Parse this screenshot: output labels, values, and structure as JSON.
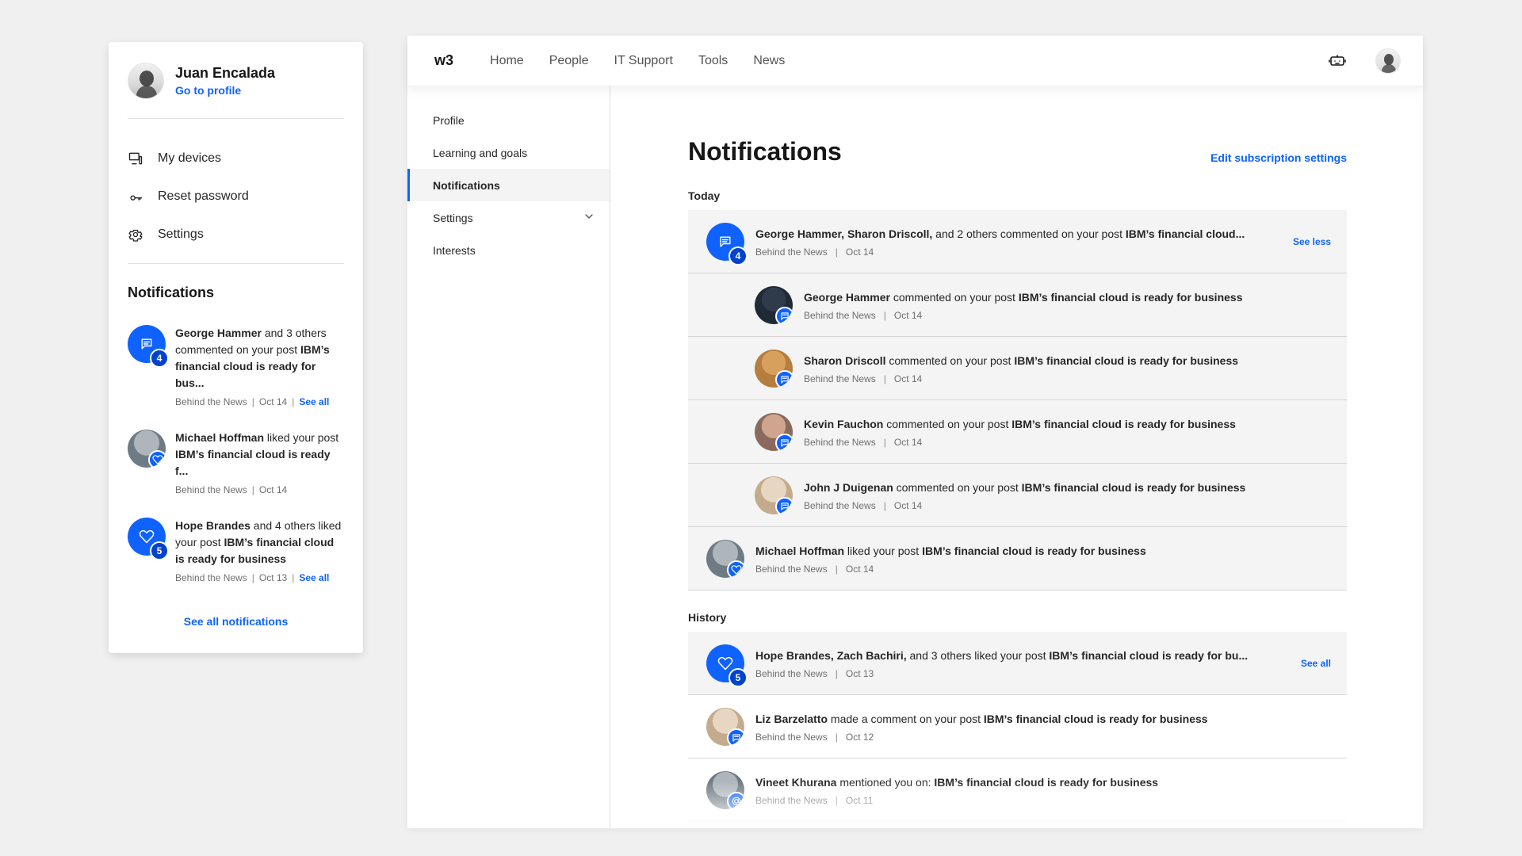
{
  "left_panel": {
    "profile": {
      "name": "Juan Encalada",
      "profile_link": "Go to profile"
    },
    "menu": [
      {
        "label": "My devices",
        "icon": "devices-icon"
      },
      {
        "label": "Reset password",
        "icon": "key-icon"
      },
      {
        "label": "Settings",
        "icon": "gear-icon"
      }
    ],
    "notifications_title": "Notifications",
    "notifications": [
      {
        "type": "group",
        "count": "4",
        "icon": "chat-icon",
        "lead": "George Hammer",
        "rest1": " and 3 others commented on your post ",
        "post": "IBM’s financial cloud is ready for bus...",
        "meta_source": "Behind the News",
        "meta_date": "Oct 14",
        "meta_link": "See all"
      },
      {
        "type": "person",
        "icon": "heart-icon",
        "lead": "Michael Hoffman",
        "rest1": " liked your post ",
        "post": "IBM’s financial cloud is ready f...",
        "meta_source": "Behind the News",
        "meta_date": "Oct 14"
      },
      {
        "type": "group",
        "count": "5",
        "icon": "heart-icon",
        "lead": "Hope Brandes",
        "rest1": " and 4 others liked your post ",
        "post": "IBM’s financial cloud is ready for business",
        "meta_source": "Behind the News",
        "meta_date": "Oct 13",
        "meta_link": "See all"
      }
    ],
    "see_all_notifications": "See all notifications"
  },
  "app": {
    "brand": "w3",
    "nav": [
      "Home",
      "People",
      "IT Support",
      "Tools",
      "News"
    ],
    "sidenav": [
      {
        "label": "Profile"
      },
      {
        "label": "Learning and goals"
      },
      {
        "label": "Notifications",
        "active": true
      },
      {
        "label": "Settings",
        "has_chevron": true
      },
      {
        "label": "Interests"
      }
    ],
    "page_title": "Notifications",
    "edit_link": "Edit subscription settings",
    "today_label": "Today",
    "history_label": "History",
    "today": [
      {
        "kind": "group",
        "count": "4",
        "icon": "chat-icon",
        "lead": "George Hammer, Sharon Driscoll,",
        "rest": " and 2 others commented on your post ",
        "post": "IBM’s financial cloud...",
        "source": "Behind the News",
        "date": "Oct 14",
        "right_link": "See less"
      },
      {
        "kind": "child",
        "avatar_style": "face-dark",
        "icon": "chat-icon",
        "lead": "George Hammer",
        "rest": " commented on your post ",
        "post": "IBM’s financial cloud is ready for business",
        "source": "Behind the News",
        "date": "Oct 14"
      },
      {
        "kind": "child",
        "avatar_style": "face-blonde",
        "icon": "chat-icon",
        "lead": "Sharon Driscoll",
        "rest": " commented on your post ",
        "post": "IBM’s financial cloud is ready for business",
        "source": "Behind the News",
        "date": "Oct 14"
      },
      {
        "kind": "child",
        "avatar_style": "face-bald",
        "icon": "chat-icon",
        "lead": "Kevin Fauchon",
        "rest": " commented on your post ",
        "post": "IBM’s financial cloud is ready for business",
        "source": "Behind the News",
        "date": "Oct 14"
      },
      {
        "kind": "child",
        "avatar_style": "face-light",
        "icon": "chat-icon",
        "lead": "John J Duigenan",
        "rest": " commented on your post ",
        "post": "IBM’s financial cloud is ready for business",
        "source": "Behind the News",
        "date": "Oct 14"
      },
      {
        "kind": "person",
        "avatar_style": "face-gray",
        "icon": "heart-icon",
        "lead": "Michael Hoffman",
        "rest": " liked your post ",
        "post": "IBM’s financial cloud is ready for business",
        "source": "Behind the News",
        "date": "Oct 14"
      }
    ],
    "history": [
      {
        "kind": "group",
        "count": "5",
        "icon": "heart-icon",
        "lead": "Hope Brandes, Zach Bachiri,",
        "rest": " and 3 others liked your post ",
        "post": "IBM’s financial cloud is ready for bu...",
        "source": "Behind the News",
        "date": "Oct 13",
        "right_link": "See all"
      },
      {
        "kind": "person_white",
        "avatar_style": "face-light",
        "icon": "chat-icon",
        "lead": "Liz Barzelatto",
        "rest": " made a comment on your post ",
        "post": "IBM’s financial cloud is ready for business",
        "source": "Behind the News",
        "date": "Oct 12"
      },
      {
        "kind": "person_white",
        "avatar_style": "face-gray",
        "icon": "at-icon",
        "lead": "Vineet Khurana",
        "rest": " mentioned you on: ",
        "post": "IBM’s financial cloud is ready for business",
        "source": "Behind the News",
        "date": "Oct 11"
      }
    ]
  },
  "colors": {
    "accent": "#0f62fe",
    "accent_dark": "#0043ce",
    "row_bg": "#f4f4f5",
    "text": "#161616",
    "muted": "#6f6f6f",
    "divider": "#e0e0e0"
  }
}
